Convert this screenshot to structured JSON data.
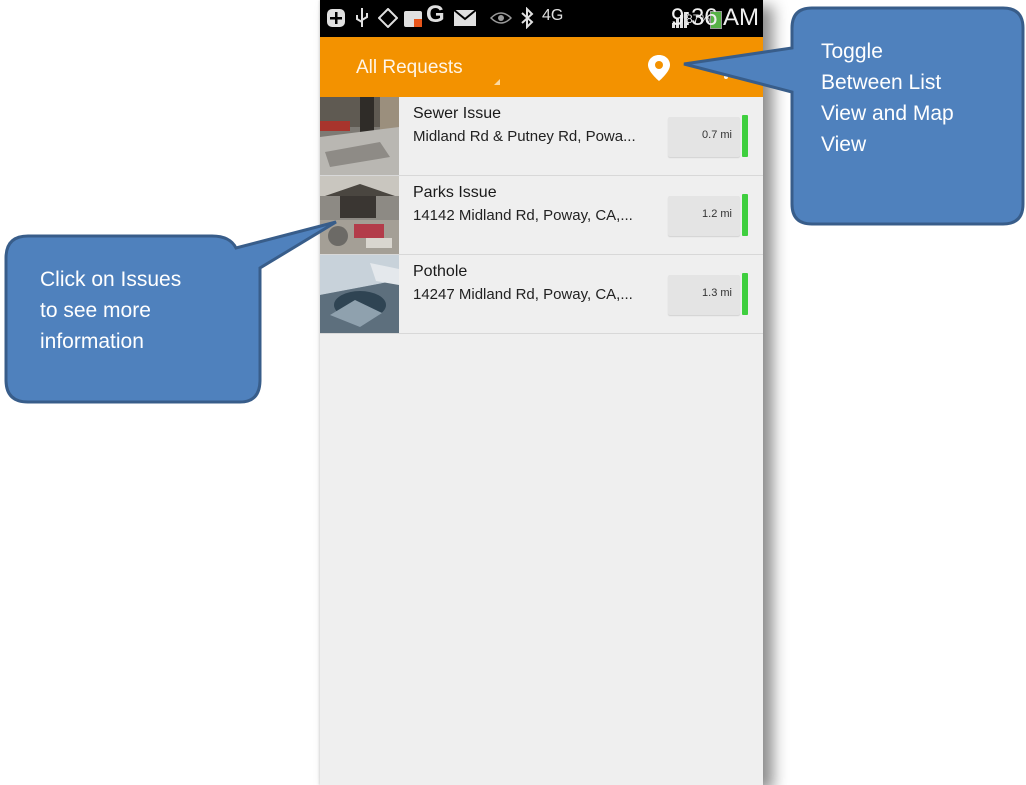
{
  "status_bar": {
    "battery_percent": "87%",
    "time": "9:36 AM",
    "network": "4G",
    "icons": [
      "plus-icon",
      "usb-icon",
      "gps-icon",
      "notification-icon",
      "google-icon",
      "mail-icon",
      "eye-icon",
      "bluetooth-icon",
      "network-4g-icon",
      "signal-icon",
      "battery-icon"
    ]
  },
  "app_bar": {
    "title": "All Requests",
    "actions": [
      "location-pin-icon",
      "overflow-menu-icon"
    ]
  },
  "requests": [
    {
      "title": "Sewer Issue",
      "address": "Midland Rd & Putney Rd, Powa...",
      "distance": "0.7 mi",
      "status_color": "#3fcf3f"
    },
    {
      "title": "Parks Issue",
      "address": "14142 Midland Rd, Poway, CA,...",
      "distance": "1.2 mi",
      "status_color": "#3fcf3f"
    },
    {
      "title": "Pothole",
      "address": "14247 Midland Rd, Poway, CA,...",
      "distance": "1.3 mi",
      "status_color": "#3fcf3f"
    }
  ],
  "callouts": {
    "left": {
      "lines": [
        "Click on Issues",
        "to see more",
        "information"
      ]
    },
    "right": {
      "lines": [
        "Toggle",
        "Between List",
        "View and Map",
        "View"
      ]
    }
  },
  "colors": {
    "app_bar": "#f39200",
    "callout_fill": "#4f81bd",
    "callout_stroke": "#385d8a",
    "status_green": "#3fcf3f"
  }
}
